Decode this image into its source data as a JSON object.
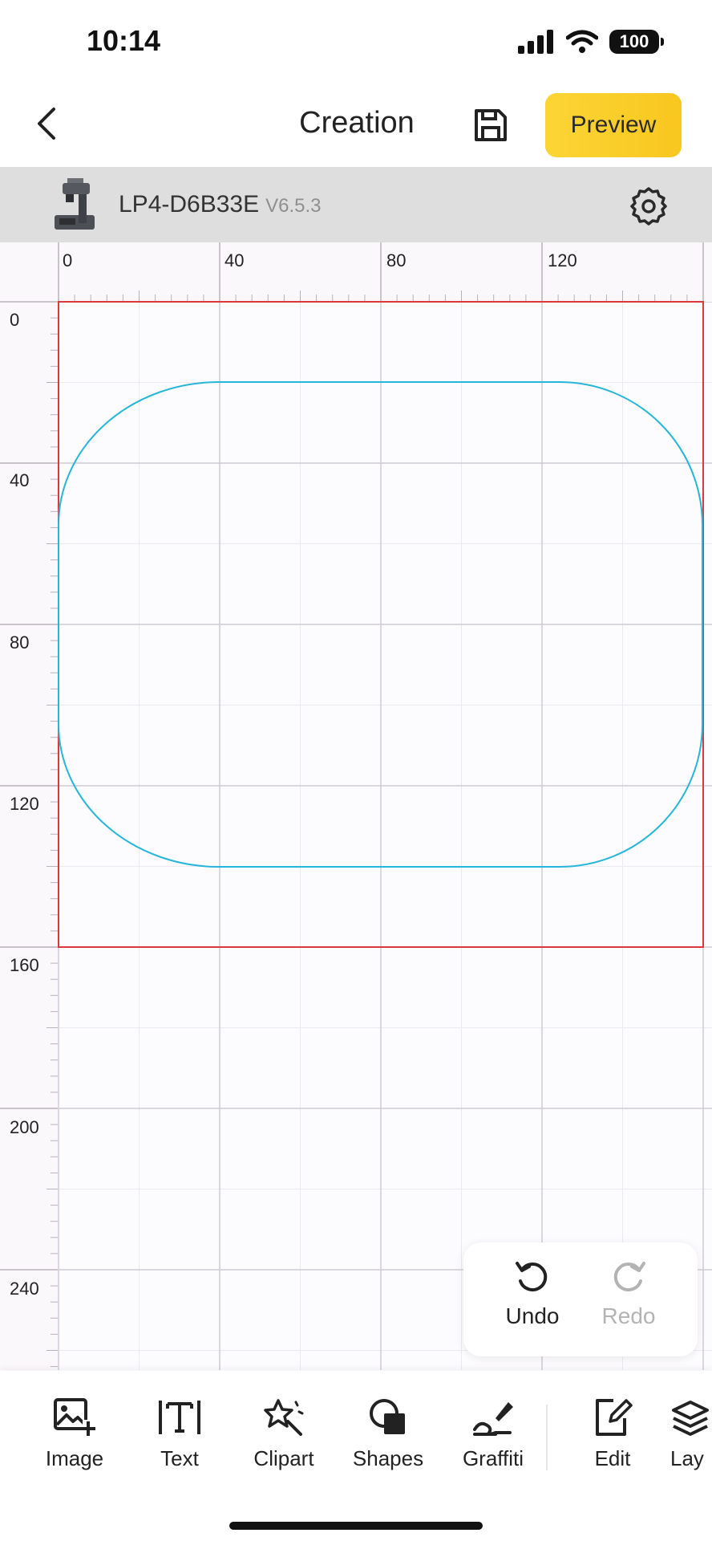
{
  "status_bar": {
    "time": "10:14",
    "battery": "100"
  },
  "nav": {
    "title": "Creation",
    "preview_label": "Preview"
  },
  "device": {
    "name": "LP4-D6B33E",
    "version": "V6.5.3"
  },
  "rulers": {
    "top_labels": [
      "0",
      "40",
      "80",
      "120"
    ],
    "left_labels": [
      "0",
      "40",
      "80",
      "120",
      "160",
      "200",
      "240"
    ]
  },
  "canvas": {
    "work_area_color": "#d9383c",
    "shape_color": "#26b6d9",
    "shape": "rounded-rectangle"
  },
  "history": {
    "undo_label": "Undo",
    "redo_label": "Redo"
  },
  "toolbar": {
    "items": [
      {
        "label": "Image",
        "icon": "image-add-icon"
      },
      {
        "label": "Text",
        "icon": "text-icon"
      },
      {
        "label": "Clipart",
        "icon": "clipart-icon"
      },
      {
        "label": "Shapes",
        "icon": "shapes-icon"
      },
      {
        "label": "Graffiti",
        "icon": "graffiti-icon"
      },
      {
        "label": "Edit",
        "icon": "edit-icon"
      },
      {
        "label": "Lay",
        "icon": "layers-icon"
      }
    ]
  },
  "colors": {
    "accent": "#f9cd2a",
    "device_bar": "#dedede"
  }
}
